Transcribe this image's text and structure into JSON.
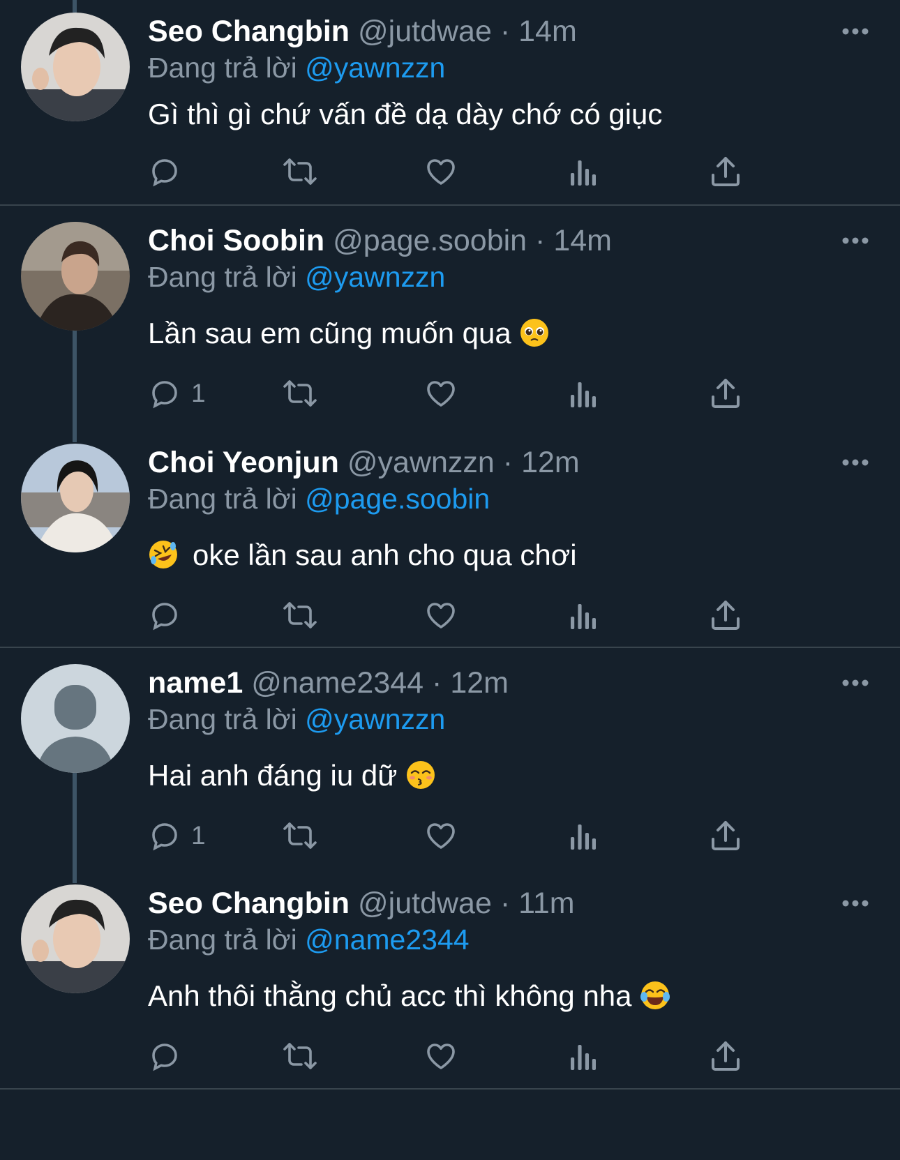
{
  "colors": {
    "background": "#15202b",
    "name": "#ffffff",
    "muted": "#8b98a5",
    "mention": "#1d9bf0",
    "divider": "#38444d",
    "thread_line": "#3d5466"
  },
  "tweets": [
    {
      "name": "Seo Changbin",
      "handle": "@jutdwae",
      "separator": "·",
      "time": "14m",
      "reply_label": "Đang trả lời",
      "reply_to": "@yawnzzn",
      "text": "Gì thì gì chứ vấn đề dạ dày chớ có giục",
      "emoji": "",
      "reply_count": ""
    },
    {
      "name": "Choi Soobin",
      "handle": "@page.soobin",
      "separator": "·",
      "time": "14m",
      "reply_label": "Đang trả lời",
      "reply_to": "@yawnzzn",
      "text": "Lần sau em cũng muốn qua",
      "emoji": "pleading-face",
      "reply_count": "1"
    },
    {
      "name": "Choi Yeonjun",
      "handle": "@yawnzzn",
      "separator": "·",
      "time": "12m",
      "reply_label": "Đang trả lời",
      "reply_to": "@page.soobin",
      "text": "oke lần sau anh cho qua chơi",
      "emoji": "rolling-on-the-floor-laughing",
      "reply_count": ""
    },
    {
      "name": "name1",
      "handle": "@name2344",
      "separator": "·",
      "time": "12m",
      "reply_label": "Đang trả lời",
      "reply_to": "@yawnzzn",
      "text": "Hai anh đáng iu dữ",
      "emoji": "kissing-face-closed-eyes",
      "reply_count": "1"
    },
    {
      "name": "Seo Changbin",
      "handle": "@jutdwae",
      "separator": "·",
      "time": "11m",
      "reply_label": "Đang trả lời",
      "reply_to": "@name2344",
      "text": "Anh thôi thằng chủ acc thì không nha",
      "emoji": "face-with-tears-of-joy",
      "reply_count": ""
    }
  ]
}
